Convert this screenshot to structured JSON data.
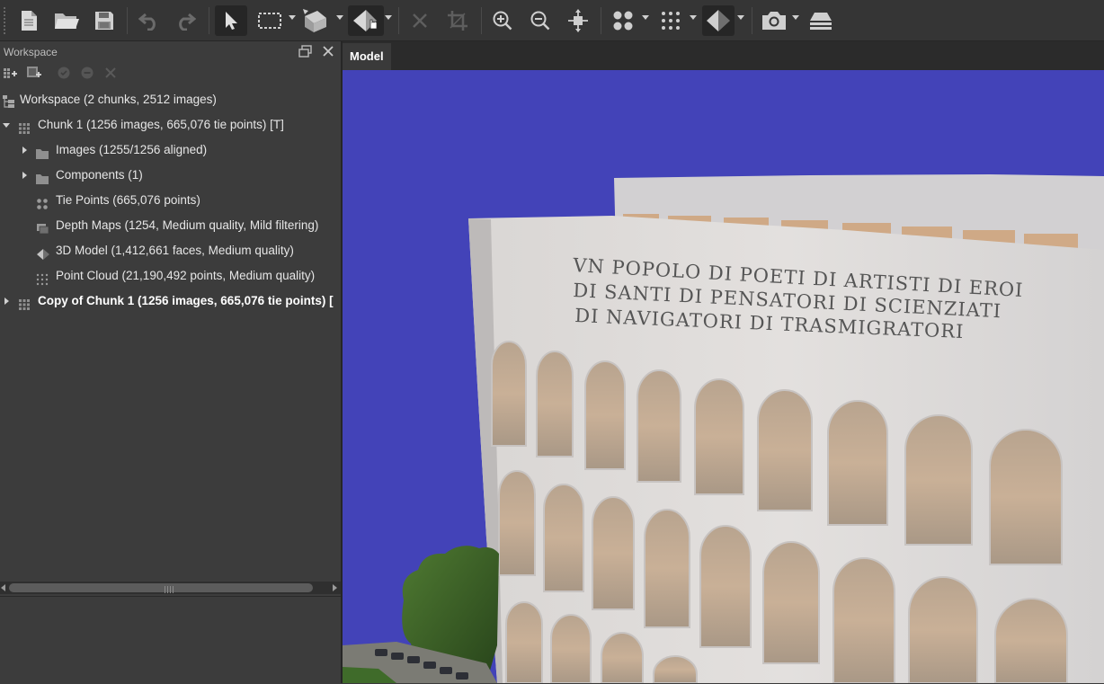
{
  "toolbar": {
    "buttons": [
      {
        "name": "new-project-icon"
      },
      {
        "name": "open-folder-icon"
      },
      {
        "name": "save-icon"
      },
      {
        "name": "undo-icon"
      },
      {
        "name": "redo-icon"
      },
      {
        "name": "navigation-arrow-icon",
        "active": true
      },
      {
        "name": "rectangle-selection-icon"
      },
      {
        "name": "transform-object-icon"
      },
      {
        "name": "model-navigation-icon",
        "active": true
      },
      {
        "name": "delete-selection-icon"
      },
      {
        "name": "crop-selection-icon"
      },
      {
        "name": "zoom-in-icon"
      },
      {
        "name": "zoom-out-icon"
      },
      {
        "name": "reset-view-icon"
      },
      {
        "name": "tie-points-view-icon"
      },
      {
        "name": "point-cloud-view-icon"
      },
      {
        "name": "model-shaded-view-icon",
        "active": true
      },
      {
        "name": "camera-icon"
      },
      {
        "name": "layers-icon"
      }
    ]
  },
  "workspace": {
    "title": "Workspace",
    "tree": {
      "root": "Workspace (2 chunks, 2512 images)",
      "chunk1": {
        "label": "Chunk 1 (1256 images, 665,076 tie points) [T]",
        "expanded": true,
        "children": [
          {
            "label": "Images (1255/1256 aligned)",
            "icon": "folder-icon",
            "expandable": true
          },
          {
            "label": "Components (1)",
            "icon": "folder-icon",
            "expandable": true
          },
          {
            "label": "Tie Points (665,076 points)",
            "icon": "tie-points-icon",
            "expandable": false
          },
          {
            "label": "Depth Maps (1254, Medium quality, Mild filtering)",
            "icon": "depth-maps-icon",
            "expandable": false
          },
          {
            "label": "3D Model (1,412,661 faces, Medium quality)",
            "icon": "model-icon",
            "expandable": false
          },
          {
            "label": "Point Cloud (21,190,492 points, Medium quality)",
            "icon": "point-cloud-icon",
            "expandable": false
          }
        ]
      },
      "chunk2": {
        "label": "Copy of Chunk 1 (1256 images, 665,076 tie points) [",
        "expanded": false,
        "active": true
      }
    }
  },
  "view": {
    "tab": "Model",
    "background_color": "#4343b8",
    "inscription": [
      "VN POPOLO DI POETI DI ARTISTI DI EROI",
      "DI SANTI DI PENSATORI DI SCIENZIATI",
      "DI NAVIGATORI DI TRASMIGRATORI"
    ]
  }
}
